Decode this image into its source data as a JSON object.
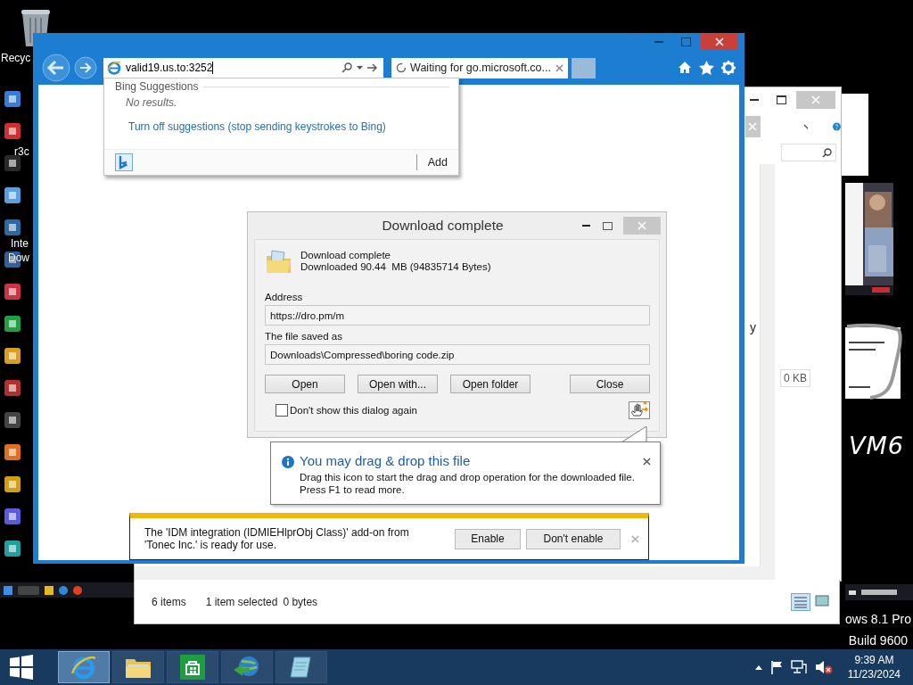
{
  "desktop": {
    "labels": [
      {
        "text": "Recyc"
      },
      {
        "text": "r3c"
      },
      {
        "text": "Inte"
      },
      {
        "text": "Dow"
      }
    ],
    "handwriting": "VM6",
    "edition": [
      "ows 8.1 Pro",
      "Build 9600"
    ]
  },
  "explorer": {
    "partial_text": "y",
    "size_badge": "0 KB",
    "status": {
      "items": "6 items",
      "selection": "1 item selected",
      "size": "0 bytes"
    }
  },
  "browser": {
    "url": "valid19.us.to:3252",
    "tabs": [
      {
        "label": "Waiting for go.microsoft.co...",
        "selected": true,
        "loading": true
      }
    ]
  },
  "suggestions": {
    "heading": "Bing Suggestions",
    "message": "No results.",
    "link": "Turn off suggestions (stop sending keystrokes to Bing)",
    "add_button": "Add"
  },
  "download_dialog": {
    "title": "Download complete",
    "status": "Download complete",
    "size_line": "Downloaded 90.44  MB (94835714 Bytes)",
    "address_label": "Address",
    "address": "https://dro.pm/m",
    "saved_label": "The file saved as",
    "saved_path": "Downloads\\Compressed\\boring code.zip",
    "buttons": [
      "Open",
      "Open with...",
      "Open folder",
      "Close"
    ],
    "dont_show": {
      "label": "Don't show this dialog again",
      "checked": false
    }
  },
  "balloon": {
    "title": "You may drag & drop this file",
    "text": "Drag this icon to start the drag and drop operation for the downloaded file. Press F1 to read more."
  },
  "notification": {
    "message": "The 'IDM integration (IDMIEHlprObj Class)' add-on from 'Tonec Inc.' is ready for use.",
    "buttons": [
      "Enable",
      "Don't enable"
    ]
  },
  "taskbar": {
    "apps": [
      {
        "kind": "browser",
        "selected": true
      },
      {
        "kind": "folder",
        "selected": false
      },
      {
        "kind": "store",
        "selected": false
      },
      {
        "kind": "downloader",
        "selected": false
      },
      {
        "kind": "notepad",
        "selected": false
      }
    ],
    "volume_muted": true,
    "time": "9:39 AM",
    "date": "11/23/2024"
  }
}
